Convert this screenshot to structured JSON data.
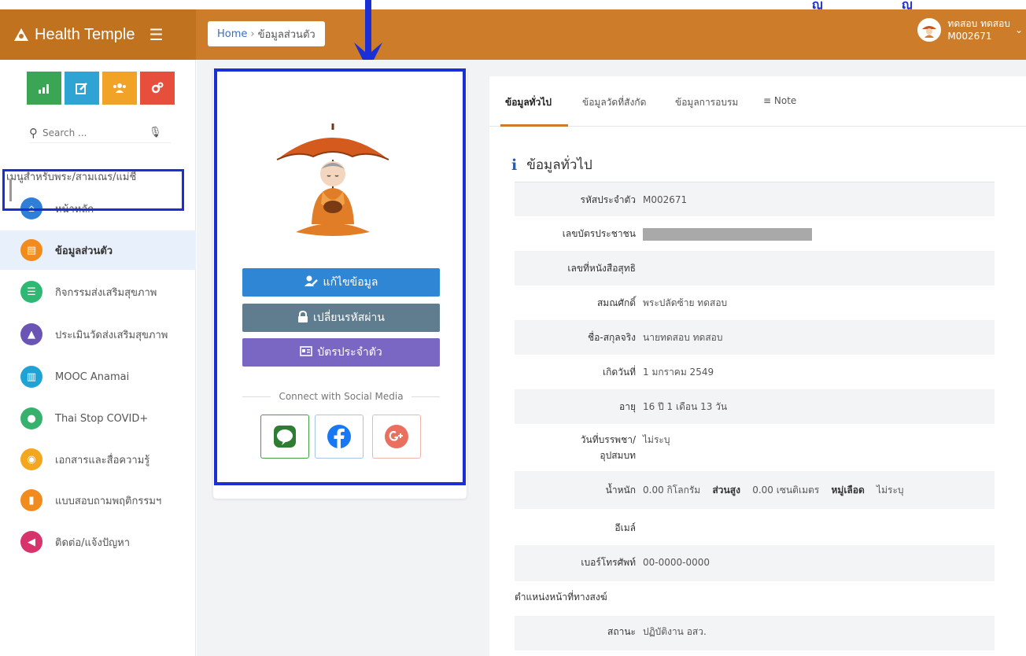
{
  "header": {
    "brand": "Health Temple",
    "breadcrumb_home": "Home",
    "breadcrumb_sep": "›",
    "breadcrumb_current": "ข้อมูลส่วนตัว",
    "user_name": "ทดสอบ ทดสอบ",
    "user_id": "M002671"
  },
  "top_partial": [
    "ญู",
    "ญู"
  ],
  "sidebar": {
    "quick_buttons": [
      {
        "icon": "chart-icon",
        "color": "#3aa655"
      },
      {
        "icon": "edit-icon",
        "color": "#2fa4d4"
      },
      {
        "icon": "users-icon",
        "color": "#f0a326"
      },
      {
        "icon": "cogs-icon",
        "color": "#e74f3d"
      }
    ],
    "search_placeholder": "Search ...",
    "menu_heading": "เมนูสำหรับพระ/สามเณร/แม่ชี",
    "items": [
      {
        "label": "หน้าหลัก",
        "icon": "home-icon",
        "color": "#2f7ed8"
      },
      {
        "label": "ข้อมูลส่วนตัว",
        "icon": "id-card-icon",
        "color": "#f28b1e"
      },
      {
        "label": "กิจกรรมส่งเสริมสุขภาพ",
        "icon": "list-icon",
        "color": "#2eb873"
      },
      {
        "label": "ประเมินวัดส่งเสริมสุขภาพ",
        "icon": "temple-icon",
        "color": "#6a55b5"
      },
      {
        "label": "MOOC Anamai",
        "icon": "book-icon",
        "color": "#1fa3d6"
      },
      {
        "label": "Thai Stop COVID+",
        "icon": "user-icon",
        "color": "#36b26e"
      },
      {
        "label": "เอกสารและสื่อความรู้",
        "icon": "bulb-icon",
        "color": "#f2a71e"
      },
      {
        "label": "แบบสอบถามพฤติกรรมฯ",
        "icon": "document-icon",
        "color": "#f28b1e"
      },
      {
        "label": "ติดต่อ/แจ้งปัญหา",
        "icon": "megaphone-icon",
        "color": "#d8336b"
      }
    ]
  },
  "profile": {
    "edit_label": "แก้ไขข้อมูล",
    "password_label": "เปลี่ยนรหัสผ่าน",
    "card_label": "บัตรประจำตัว",
    "social_title": "Connect with Social Media",
    "colors": {
      "edit": "#2f86d5",
      "password": "#5f7d8f",
      "card": "#7a67c4"
    }
  },
  "tabs": [
    "ข้อมูลทั่วไป",
    "ข้อมูลวัดที่สังกัด",
    "ข้อมูลการอบรม",
    "Note"
  ],
  "section_title": "ข้อมูลทั่วไป",
  "info": {
    "member_id_label": "รหัสประจำตัว",
    "member_id": "M002671",
    "citizen_id_label": "เลขบัตรประชาชน",
    "ordination_doc_label": "เลขที่หนังสือสุทธิ",
    "rank_label": "สมณศักดิ์",
    "rank": "พระปลัดซ้าย ทดสอบ",
    "name_label": "ชื่อ-สกุลจริง",
    "name": "นายทดสอบ ทดสอบ",
    "birth_label": "เกิดวันที่",
    "birth": "1 มกราคม 2549",
    "age_label": "อายุ",
    "age": "16 ปี 1 เดือน 13 วัน",
    "ordain_label_1": "วันที่บรรพชา/",
    "ordain_label_2": "อุปสมบท",
    "ordain": "ไม่ระบุ",
    "weight_label": "น้ำหนัก",
    "weight": "0.00 กิโลกรัม",
    "height_label": "ส่วนสูง",
    "height": "0.00 เซนติเมตร",
    "blood_label": "หมู่เลือด",
    "blood": "ไม่ระบุ",
    "email_label": "อีเมล์",
    "phone_label": "เบอร์โทรศัพท์",
    "phone": "00-0000-0000",
    "position_label": "ตำแหน่งหน้าที่ทางสงฆ์",
    "status_label": "สถานะ",
    "status": "ปฏิบัติงาน อสว."
  }
}
